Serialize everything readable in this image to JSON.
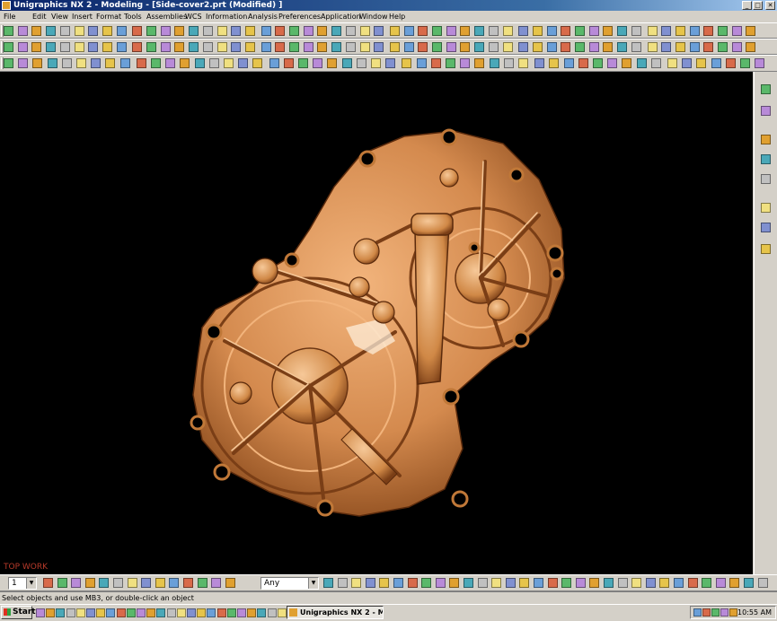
{
  "window": {
    "title": "Unigraphics NX 2 - Modeling - [Side-cover2.prt (Modified) ]",
    "minimize_glyph": "_",
    "maximize_glyph": "□",
    "close_glyph": "✕"
  },
  "menu": {
    "items": [
      "File",
      "Edit",
      "View",
      "Insert",
      "Format",
      "Tools",
      "Assemblies",
      "WCS",
      "Information",
      "Analysis",
      "Preferences",
      "Application",
      "Window",
      "Help"
    ]
  },
  "toolbars": {
    "row1_icons": [
      "new-icon",
      "open-icon",
      "save-icon",
      "cut-icon",
      "undo-icon",
      "pen-icon",
      "brush-icon",
      "info-icon",
      "fit-icon",
      "zoom-icon",
      "rotate-icon",
      "pan-icon",
      "refresh-icon",
      "perspective-icon",
      "layer-icon",
      "shade-icon",
      "wireframe-icon",
      "color-icon",
      "hide-icon",
      "measure-icon",
      "sketch-icon",
      "line-icon",
      "arc-icon",
      "point-icon",
      "curve-icon",
      "plane-icon",
      "datum-icon",
      "extrude-icon",
      "revolve-icon",
      "sweep-icon",
      "hole-icon",
      "boss-icon",
      "pocket-icon",
      "pad-icon",
      "slot-icon",
      "groove-icon",
      "blend-icon",
      "chamfer-icon",
      "shell-icon",
      "draft-icon",
      "trim-icon",
      "split-icon",
      "mirror-icon",
      "pattern-icon",
      "unite-icon",
      "subtract-icon",
      "intersect-icon",
      "offset-icon",
      "scale-icon",
      "sew-icon",
      "patch-icon",
      "analysis-icon",
      "section-icon"
    ],
    "row2_icons": [
      "point-icon",
      "plus-icon",
      "spline-icon",
      "conic-icon",
      "helix-icon",
      "offset-curve-icon",
      "bridge-icon",
      "project-icon",
      "intersect-curve-icon",
      "isoparm-icon",
      "wrap-icon",
      "extract-icon",
      "combine-icon",
      "join-icon",
      "simplify-icon",
      "divide-icon",
      "trim-curve-icon",
      "fillet-curve-icon",
      "stretch-icon",
      "length-icon",
      "edit-curve-icon",
      "sheet-icon",
      "ruled-icon",
      "mesh-icon",
      "through-icon",
      "swept-icon",
      "section-surf-icon",
      "bounded-icon",
      "fillet-surf-icon",
      "extension-icon",
      "offset-surf-icon",
      "quilt-icon",
      "global-icon",
      "enlarge-icon",
      "transform-icon",
      "move-icon",
      "copy-icon",
      "delete-icon",
      "blank-icon",
      "unblank-icon",
      "class-icon",
      "filter-icon",
      "attribute-icon",
      "expression-icon",
      "part-nav-icon",
      "assembly-icon",
      "reference-icon",
      "component-icon",
      "constraint-icon",
      "explode-icon",
      "sequence-icon",
      "clearance-icon",
      "weight-icon"
    ],
    "row3_icons": [
      "face-icon",
      "body-icon",
      "edge-icon",
      "feature-icon",
      "sketch-filter-icon",
      "curve-filter-icon",
      "surface-icon",
      "solid-icon",
      "datum-plane-icon",
      "datum-axis-icon",
      "csys-icon",
      "view-icon",
      "layer-icon",
      "group-icon",
      "snap-icon",
      "endpoint-icon",
      "midpoint-icon",
      "center-icon",
      "quadrant-icon",
      "existing-icon",
      "on-curve-icon",
      "on-face-icon",
      "intersection-icon",
      "point-constructor-icon",
      "vector-icon",
      "plane-constructor-icon",
      "csys-constructor-icon",
      "class-select-icon",
      "deselect-icon",
      "select-all-icon",
      "isometric-icon",
      "top-icon",
      "front-icon",
      "right-icon",
      "left-icon",
      "back-icon",
      "bottom-icon",
      "trimetric-icon",
      "fit-all-icon",
      "zoom-box-icon",
      "shaded-icon",
      "studio-icon",
      "light-icon",
      "camera-icon",
      "render-icon",
      "texture-icon",
      "material-icon",
      "bulb-icon",
      "monitor-icon",
      "photo-icon",
      "movie-icon",
      "help-icon"
    ],
    "right_icons": [
      "part-navigator-icon",
      "assembly-navigator-icon",
      "resource-icon",
      "history-icon",
      "web-icon",
      "roles-icon",
      "help-icon",
      "palette-icon",
      "system-icon",
      "reuse-icon"
    ],
    "bottom_icons": [
      "select-icon",
      "filter-icon",
      "quick-pick-icon",
      "face-select-icon",
      "body-select-icon",
      "edge-select-icon",
      "snap-point-icon",
      "snap-end-icon",
      "snap-mid-icon",
      "snap-center-icon",
      "snap-control-icon",
      "snap-intersect-icon",
      "snap-arc-icon",
      "snap-quadrant-icon",
      "snap-existing-icon",
      "snap-on-curve-icon",
      "snap-on-face-icon",
      "snap-bounded-icon",
      "view-triad-icon",
      "feature-icon",
      "sketch-icon",
      "curve-icon",
      "datum-icon",
      "solid-icon",
      "sheet-icon",
      "facet-icon",
      "csys-icon",
      "measure-icon",
      "distance-icon",
      "angle-icon",
      "radius-icon",
      "volume-icon",
      "mass-icon",
      "section-icon",
      "clearance-icon",
      "interference-icon",
      "deviation-icon",
      "draft-icon",
      "curvature-icon",
      "reflection-icon",
      "slope-icon",
      "zebra-icon",
      "hilite-icon",
      "undo-icon",
      "redo-icon",
      "refresh-icon"
    ]
  },
  "selection": {
    "layer_value": "1",
    "filter_value": "Any"
  },
  "viewport": {
    "background": "#000000",
    "part_color": "#d48a4e",
    "part_highlight": "#f2b47c",
    "part_shadow": "#7a3e16",
    "view_label": "TOP WORK",
    "view_label_color": "#b83a2a"
  },
  "status": {
    "prompt": "Select objects and use MB3, or double-click an object"
  },
  "taskbar": {
    "start_label": "Start",
    "task_label": "Unigraphics NX 2 - Mo...",
    "clock": "10:55 AM",
    "quick_launch_icons": [
      "explorer-icon",
      "ie-icon",
      "outlook-icon",
      "folder-icon",
      "word-icon",
      "excel-icon",
      "media-icon",
      "paint-icon",
      "calc-icon",
      "notepad-icon",
      "acrobat-icon",
      "winzip-icon",
      "cad-icon",
      "mail-icon",
      "disk-icon",
      "network-icon",
      "printer-icon",
      "search-icon",
      "run-icon",
      "settings-icon",
      "music-icon",
      "photo-icon",
      "chat-icon",
      "help-icon",
      "desktop-icon"
    ],
    "tray_icons": [
      "network-tray-icon",
      "antivirus-tray-icon",
      "volume-tray-icon",
      "printer-tray-icon",
      "shield-tray-icon"
    ]
  }
}
